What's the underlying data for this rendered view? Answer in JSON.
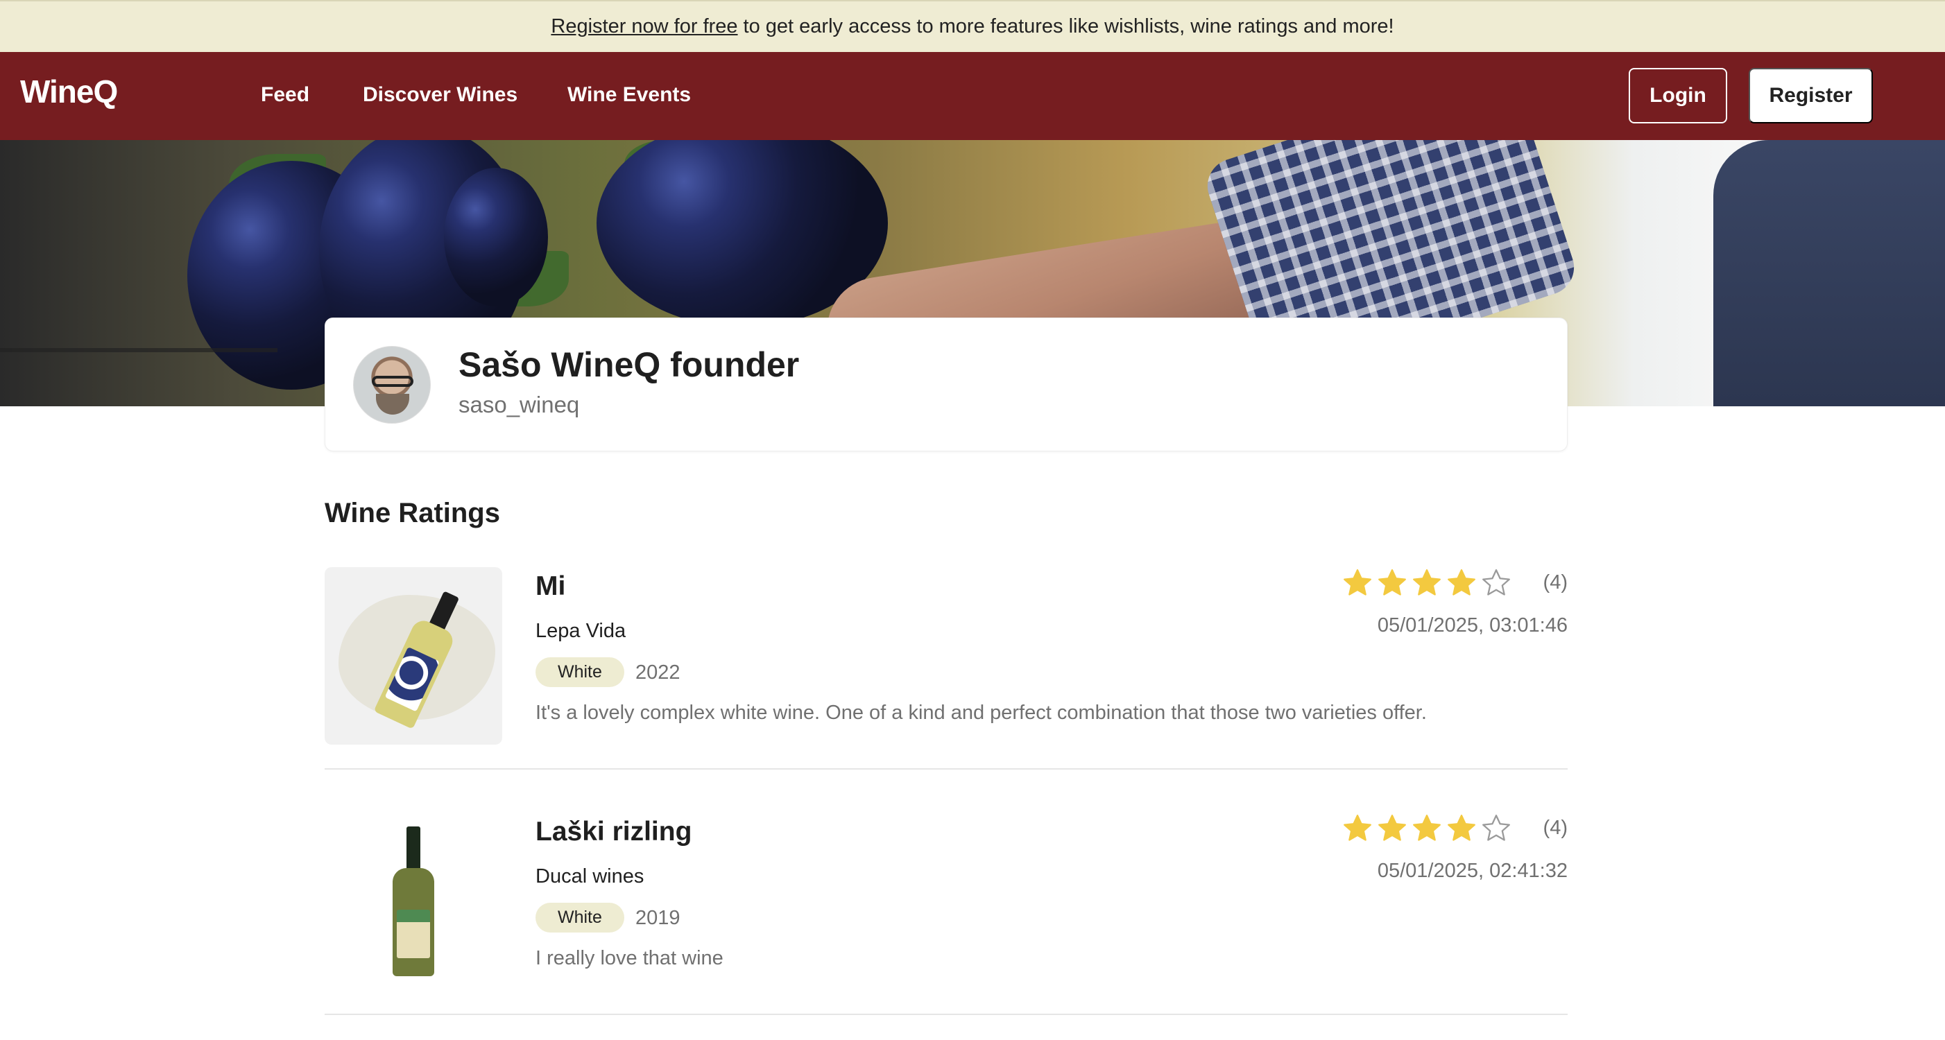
{
  "banner": {
    "link_text": "Register now for free",
    "text": "to get early access to more features like wishlists, wine ratings and more!"
  },
  "nav": {
    "logo": "WineQ",
    "links": [
      "Feed",
      "Discover Wines",
      "Wine Events"
    ],
    "login_label": "Login",
    "register_label": "Register"
  },
  "profile": {
    "name": "Sašo WineQ founder",
    "handle": "saso_wineq"
  },
  "ratings_section": {
    "title": "Wine Ratings",
    "items": [
      {
        "name": "Mi",
        "winery": "Lepa Vida",
        "type": "White",
        "year": "2022",
        "comment": "It's a lovely complex white wine. One of a kind and perfect combination that those two varieties offer.",
        "stars": 4,
        "stars_max": 5,
        "count_label": "(4)",
        "timestamp": "05/01/2025, 03:01:46"
      },
      {
        "name": "Laški rizling",
        "winery": "Ducal wines",
        "type": "White",
        "year": "2019",
        "comment": "I really love that wine",
        "stars": 4,
        "stars_max": 5,
        "count_label": "(4)",
        "timestamp": "05/01/2025, 02:41:32"
      }
    ]
  },
  "colors": {
    "brand": "#761d20",
    "banner_bg": "#efecd3",
    "star_fill": "#f3c93f",
    "tag_bg": "#eeecd2"
  },
  "icons": {
    "star": "star-icon"
  }
}
